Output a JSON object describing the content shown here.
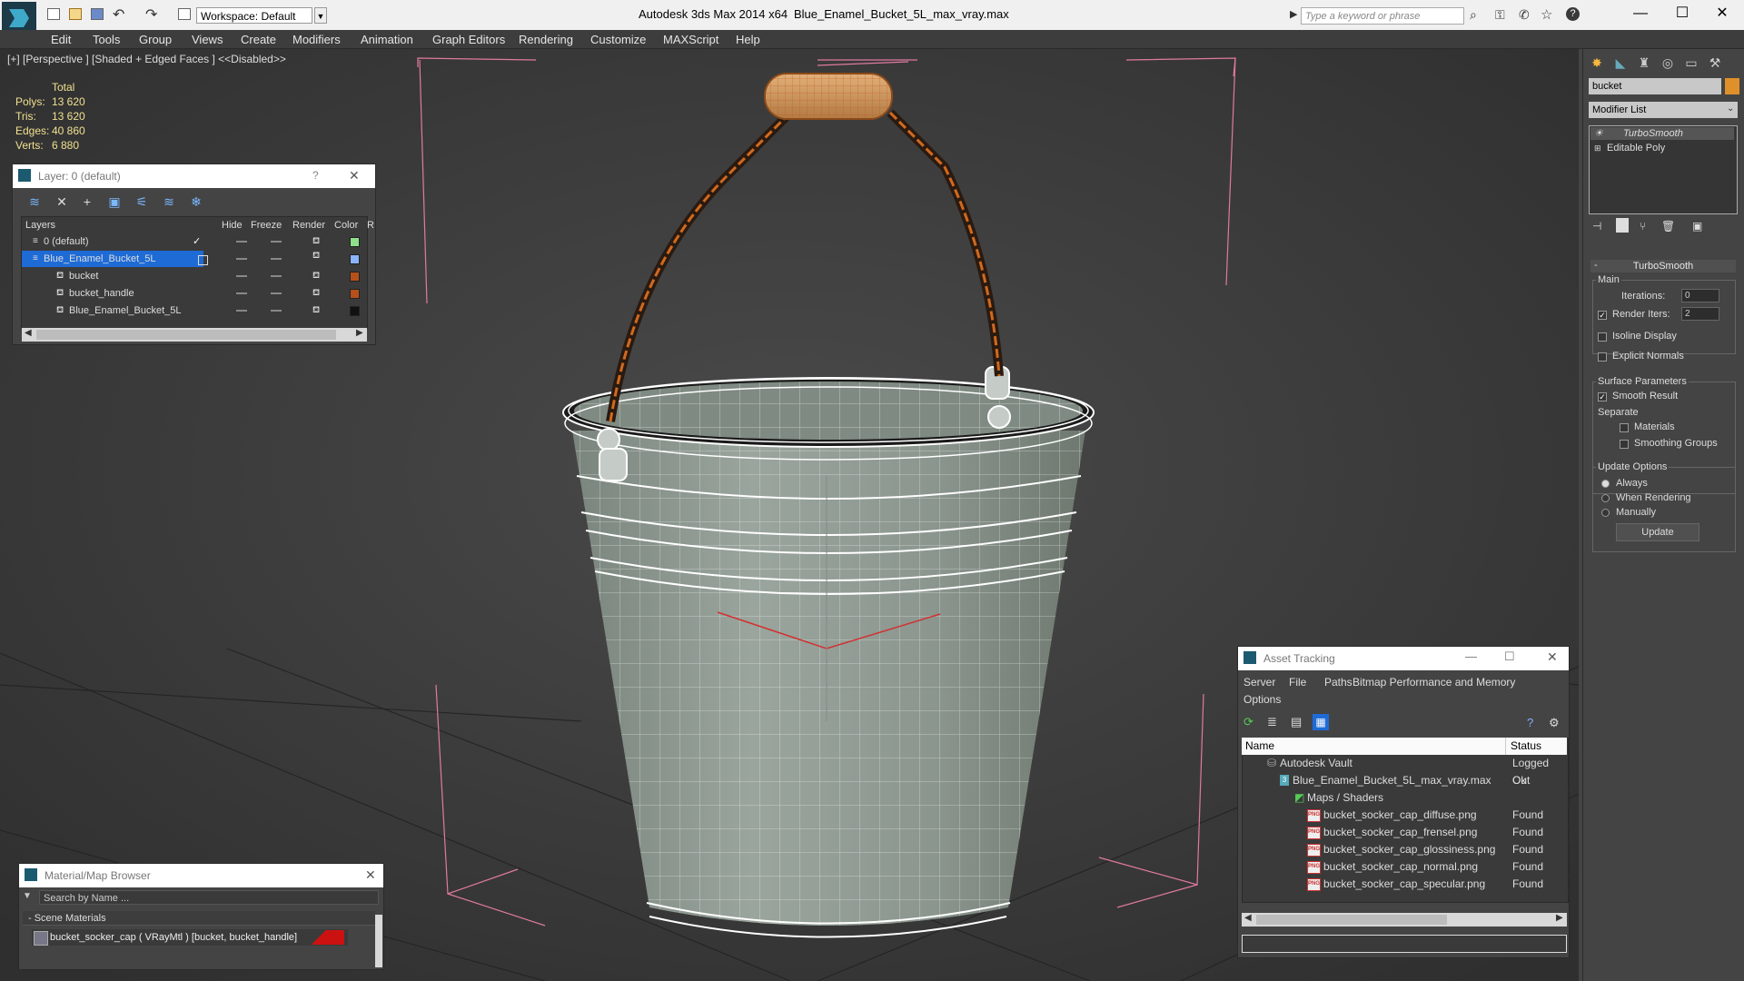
{
  "title_bar": {
    "app_title": "Autodesk 3ds Max  2014 x64",
    "file_title": "Blue_Enamel_Bucket_5L_max_vray.max",
    "workspace": "Workspace: Default",
    "search_placeholder": "Type a keyword or phrase",
    "minimize": "—",
    "maximize": "☐",
    "close": "✕"
  },
  "menu": [
    "Edit",
    "Tools",
    "Group",
    "Views",
    "Create",
    "Modifiers",
    "Animation",
    "Graph Editors",
    "Rendering",
    "Customize",
    "MAXScript",
    "Help"
  ],
  "viewport": {
    "label": "[+] [Perspective ] [Shaded + Edged Faces ]  <<Disabled>>",
    "stats_header": "Total",
    "stats": [
      {
        "label": "Polys:",
        "value": "13 620"
      },
      {
        "label": "Tris:",
        "value": "13 620"
      },
      {
        "label": "Edges:",
        "value": "40 860"
      },
      {
        "label": "Verts:",
        "value": "6 880"
      }
    ]
  },
  "layer_window": {
    "title": "Layer: 0 (default)",
    "help": "?",
    "close": "✕",
    "columns": [
      "Layers",
      "Hide",
      "Freeze",
      "Render",
      "Color",
      "R"
    ],
    "rows": [
      {
        "name": "0 (default)",
        "color": "#8fe08a"
      },
      {
        "name": "Blue_Enamel_Bucket_5L",
        "color": "#8ab4ff"
      },
      {
        "name": "bucket",
        "color": "#b5501a"
      },
      {
        "name": "bucket_handle",
        "color": "#b5501a"
      },
      {
        "name": "Blue_Enamel_Bucket_5L",
        "color": "#111111"
      }
    ]
  },
  "material_browser": {
    "title": "Material/Map Browser",
    "close": "✕",
    "search_placeholder": "Search by Name ...",
    "group": "- Scene Materials",
    "material": "bucket_socker_cap  ( VRayMtl )  [bucket, bucket_handle]"
  },
  "asset_tracking": {
    "title": "Asset Tracking",
    "menus": [
      "Server",
      "File",
      "Paths",
      "Bitmap Performance and Memory",
      "Options"
    ],
    "col_name": "Name",
    "col_status": "Status",
    "rows": [
      {
        "name": "Autodesk Vault",
        "status": "Logged Out",
        "indent": 1
      },
      {
        "name": "Blue_Enamel_Bucket_5L_max_vray.max",
        "status": "Ok",
        "indent": 2
      },
      {
        "name": "Maps / Shaders",
        "status": "",
        "indent": 3
      },
      {
        "name": "bucket_socker_cap_diffuse.png",
        "status": "Found",
        "indent": 4
      },
      {
        "name": "bucket_socker_cap_frensel.png",
        "status": "Found",
        "indent": 4
      },
      {
        "name": "bucket_socker_cap_glossiness.png",
        "status": "Found",
        "indent": 4
      },
      {
        "name": "bucket_socker_cap_normal.png",
        "status": "Found",
        "indent": 4
      },
      {
        "name": "bucket_socker_cap_specular.png",
        "status": "Found",
        "indent": 4
      }
    ],
    "png_label": "PNG"
  },
  "command_panel": {
    "object_name": "bucket",
    "modifier_list": "Modifier List",
    "stack": [
      "TurboSmooth",
      "Editable Poly"
    ],
    "rollout_title": "TurboSmooth",
    "main_label": "Main",
    "iterations_label": "Iterations:",
    "iterations_value": "0",
    "render_iters_label": "Render Iters:",
    "render_iters_value": "2",
    "isoline": "Isoline Display",
    "explicit_normals": "Explicit Normals",
    "surface_params": "Surface Parameters",
    "smooth_result": "Smooth Result",
    "separate": "Separate",
    "materials": "Materials",
    "smoothing_groups": "Smoothing Groups",
    "update_options": "Update Options",
    "always": "Always",
    "when_rendering": "When Rendering",
    "manually": "Manually",
    "update_button": "Update"
  },
  "colors": {
    "accent_orange": "#e0902a",
    "selection_blue": "#1e6bd6",
    "stats_yellow": "#f0e090",
    "viewport_bg": "#3b3b3b",
    "material_swatch": "#cc1111"
  }
}
